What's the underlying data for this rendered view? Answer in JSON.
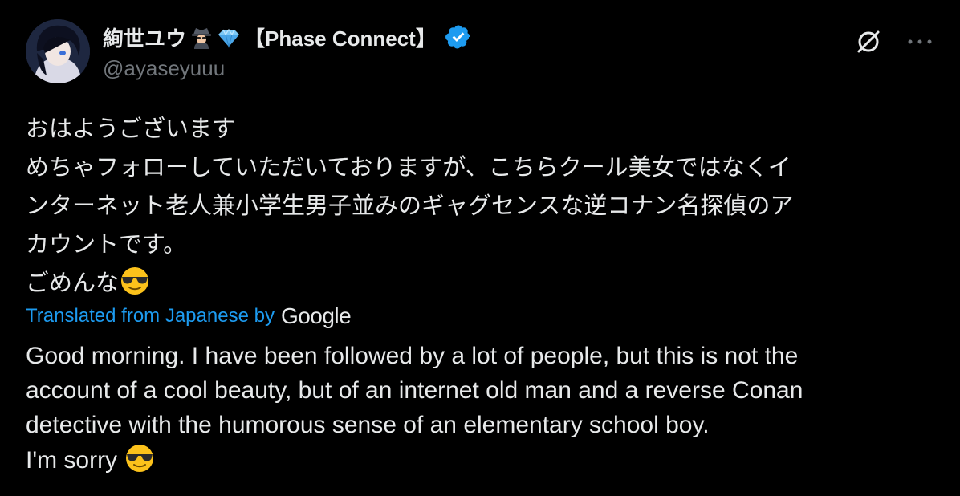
{
  "author": {
    "display_name": "絢世ユウ",
    "org_tag": "【Phase Connect】",
    "handle": "@ayaseyuuu",
    "name_icons": [
      "detective-icon",
      "gem-icon"
    ],
    "verified_color": "#1d9bf0"
  },
  "actions": {
    "grok_icon": "grok-icon",
    "more_icon": "more-icon"
  },
  "post": {
    "original_lines": [
      "おはようございます",
      "めちゃフォローしていただいておりますが、こちらクール美女ではなくイ",
      "ンターネット老人兼小学生男子並みのギャグセンスな逆コナン名探偵のア",
      "カウントです。",
      "ごめんな"
    ],
    "original_trailing_emoji": "sunglasses-face-icon",
    "translation_label": "Translated from Japanese by",
    "translation_provider": "Google",
    "translated_lines": [
      "Good morning. I have been followed by a lot of people, but this is not the",
      "account of a cool beauty, but of an internet old man and a reverse Conan",
      "detective with the humorous sense of an elementary school boy.",
      "I'm sorry"
    ],
    "translated_trailing_emoji": "sunglasses-face-icon"
  },
  "colors": {
    "background": "#000000",
    "text": "#e7e9ea",
    "secondary_text": "#71767b",
    "link": "#1d9bf0"
  }
}
